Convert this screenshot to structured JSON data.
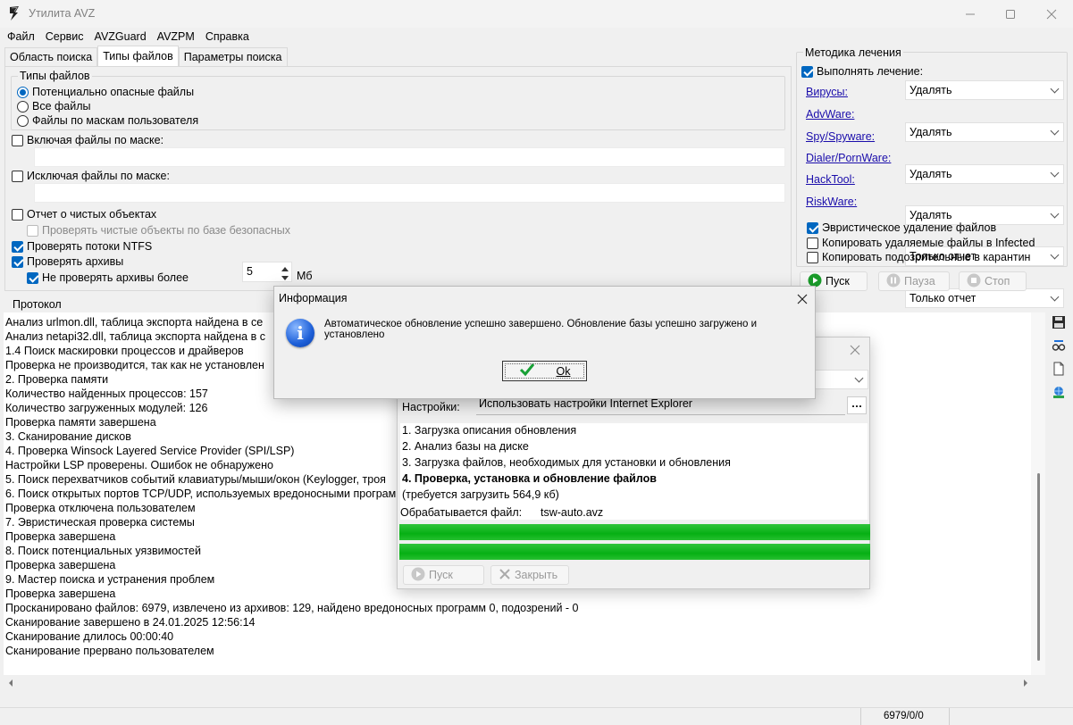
{
  "window": {
    "title": "Утилита AVZ"
  },
  "menu": [
    "Файл",
    "Сервис",
    "AVZGuard",
    "AVZPM",
    "Справка"
  ],
  "tabs": [
    "Область поиска",
    "Типы файлов",
    "Параметры поиска"
  ],
  "file_types": {
    "group_title": "Типы файлов",
    "options": [
      "Потенциально опасные файлы",
      "Все файлы",
      "Файлы по маскам пользователя"
    ],
    "selected_index": 0
  },
  "masks": {
    "include_label": "Включая файлы по маске:",
    "include_value": "",
    "exclude_label": "Исключая файлы по маске:",
    "exclude_value": ""
  },
  "options": {
    "clean_report": "Отчет о чистых объектах",
    "check_clean": "Проверять чистые объекты по базе безопасных",
    "ntfs_streams": "Проверять потоки NTFS",
    "archives": "Проверять архивы",
    "skip_archives": "Не проверять архивы более",
    "skip_archives_value": "5",
    "skip_archives_unit": "Мб"
  },
  "treatment": {
    "group_title": "Методика лечения",
    "perform_label": "Выполнять лечение:",
    "rows": [
      {
        "label": "Вирусы:",
        "value": "Удалять"
      },
      {
        "label": "AdvWare:",
        "value": "Удалять"
      },
      {
        "label": "Spy/Spyware:",
        "value": "Удалять"
      },
      {
        "label": "Dialer/PornWare:",
        "value": "Удалять"
      },
      {
        "label": "HackTool:",
        "value": "Только отчет"
      },
      {
        "label": "RiskWare:",
        "value": "Только отчет"
      }
    ],
    "heuristic_delete": "Эвристическое удаление файлов",
    "copy_deleted": "Копировать удаляемые файлы в  Infected",
    "copy_suspicious": "Копировать подозрительные в  карантин"
  },
  "controls": {
    "start": "Пуск",
    "pause": "Пауза",
    "stop": "Стоп"
  },
  "protocol": {
    "label": "Протокол",
    "lines": [
      " Анализ urlmon.dll, таблица экспорта найдена в се",
      " Анализ netapi32.dll, таблица экспорта найдена в с",
      "1.4 Поиск маскировки процессов и драйверов",
      " Проверка не производится, так как не установлен",
      "2. Проверка памяти",
      " Количество найденных процессов: 157",
      " Количество загруженных модулей: 126",
      "Проверка памяти завершена",
      "3. Сканирование дисков",
      "4. Проверка Winsock Layered Service Provider (SPI/LSP)",
      " Настройки LSP проверены. Ошибок не обнаружено",
      "5. Поиск перехватчиков событий клавиатуры/мыши/окон (Keylogger, троя",
      "6. Поиск открытых портов TCP/UDP, используемых вредоносными програм",
      " Проверка отключена пользователем",
      "7. Эвристическая проверка системы",
      "Проверка завершена",
      "8. Поиск потенциальных уязвимостей",
      "Проверка завершена",
      "9. Мастер поиска и устранения проблем",
      "Проверка завершена",
      "Просканировано файлов: 6979, извлечено из архивов: 129, найдено вредоносных программ 0, подозрений - 0",
      "Сканирование завершено в 24.01.2025 12:56:14",
      "Сканирование длилось 00:00:40",
      "Сканирование прервано пользователем"
    ]
  },
  "status_bar": {
    "counter": "6979/0/0"
  },
  "update_dialog": {
    "settings_label": "Настройки:",
    "settings_value": "Использовать настройки Internet Explorer",
    "steps": [
      "1. Загрузка описания обновления",
      "2. Анализ базы на диске",
      "3. Загрузка файлов, необходимых для установки и обновления",
      "4. Проверка, установка и обновление файлов"
    ],
    "required": "(требуется загрузить 564,9 кб)",
    "processing_label": "Обрабатывается файл:",
    "processing_file": "tsw-auto.avz",
    "progress_top": 1.0,
    "progress_bottom": 1.0,
    "start_button": "Пуск",
    "close_button": "Закрыть"
  },
  "info_dialog": {
    "title": "Информация",
    "message": "Автоматическое обновление успешно завершено. Обновление базы успешно загружено и установлено",
    "ok_label": "Ok"
  },
  "colors": {
    "accent": "#0067c0",
    "progress": "#06b014",
    "link": "#1a0dab"
  }
}
